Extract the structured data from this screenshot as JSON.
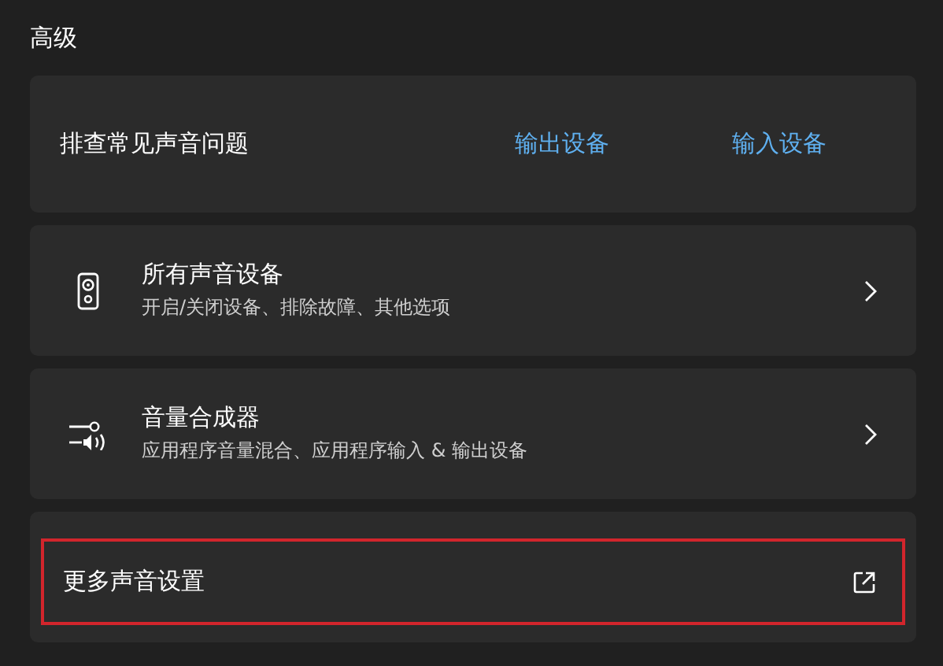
{
  "section_title": "高级",
  "cards": [
    {
      "kind": "links",
      "title": "排查常见声音问题",
      "links": [
        "输出设备",
        "输入设备"
      ]
    },
    {
      "kind": "nav",
      "title": "所有声音设备",
      "subtitle": "开启/关闭设备、排除故障、其他选项",
      "highlighted": false
    },
    {
      "kind": "nav",
      "title": "音量合成器",
      "subtitle": "应用程序音量混合、应用程序输入 & 输出设备",
      "highlighted": false
    },
    {
      "kind": "launch",
      "title": "更多声音设置",
      "highlighted": true
    }
  ]
}
